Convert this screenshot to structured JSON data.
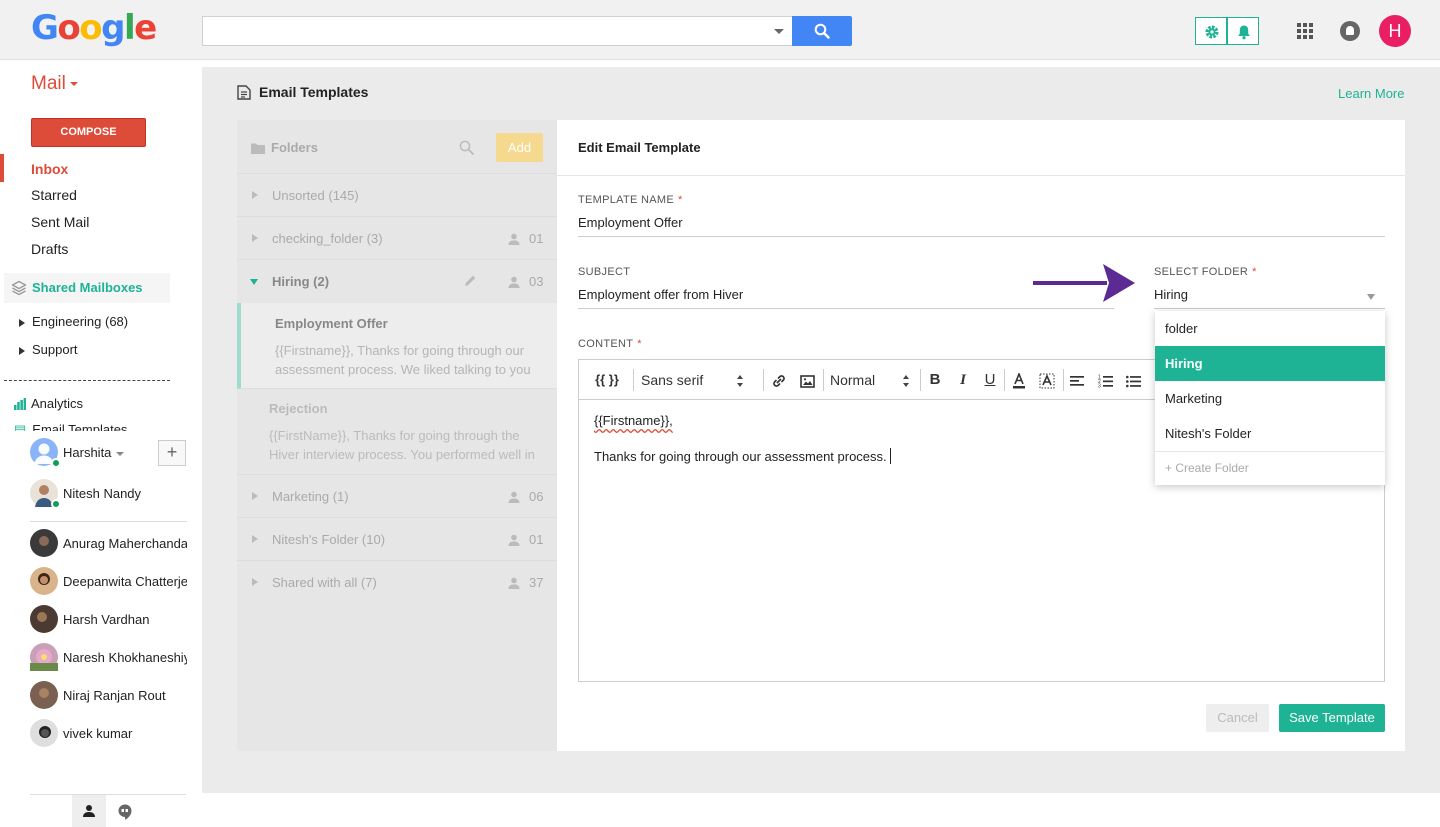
{
  "header": {
    "logo_letters": [
      "G",
      "o",
      "o",
      "g",
      "l",
      "e"
    ],
    "search_value": "",
    "avatar_letter": "H"
  },
  "nav": {
    "mail_label": "Mail",
    "compose_label": "COMPOSE",
    "items": [
      "Inbox",
      "Starred",
      "Sent Mail",
      "Drafts"
    ],
    "shared_mailboxes": "Shared Mailboxes",
    "mailboxes": [
      "Engineering (68)",
      "Support"
    ],
    "analytics": "Analytics",
    "email_templates": "Email Templates",
    "contacts": [
      "Harshita",
      "Nitesh Nandy",
      "Anurag Maherchandani",
      "Deepanwita Chatterjee",
      "Harsh Vardhan",
      "Naresh Khokhaneshiya",
      "Niraj Ranjan Rout",
      "vivek kumar"
    ]
  },
  "page": {
    "title": "Email Templates",
    "learn_more": "Learn More"
  },
  "folders": {
    "header": "Folders",
    "add_label": "Add",
    "rows": [
      {
        "name": "Unsorted (145)",
        "count": ""
      },
      {
        "name": "checking_folder (3)",
        "count": "01"
      },
      {
        "name": "Hiring (2)",
        "count": "03"
      },
      {
        "name": "Marketing (1)",
        "count": "06"
      },
      {
        "name": "Nitesh's Folder (10)",
        "count": "01"
      },
      {
        "name": "Shared with all (7)",
        "count": "37"
      }
    ],
    "templates": [
      {
        "title": "Employment Offer",
        "preview": "{{Firstname}}, Thanks for going through our assessment process. We liked talking to you"
      },
      {
        "title": "Rejection",
        "preview": "{{FirstName}}, Thanks for going through the Hiver interview process. You performed well in"
      }
    ]
  },
  "editor": {
    "header": "Edit Email Template",
    "template_name_label": "TEMPLATE NAME",
    "template_name_value": "Employment Offer",
    "subject_label": "SUBJECT",
    "subject_value": "Employment offer from Hiver",
    "select_folder_label": "SELECT FOLDER",
    "select_folder_value": "Hiring",
    "content_label": "CONTENT",
    "required_mark": "*",
    "toolbar": {
      "variables": "{{ }}",
      "font": "Sans serif",
      "size": "Normal"
    },
    "body_line1": "{{Firstname}},",
    "body_line2": "Thanks for going through our assessment process.",
    "cancel_label": "Cancel",
    "save_label": "Save Template"
  },
  "dropdown": {
    "options": [
      "folder",
      "Hiring",
      "Marketing",
      "Nitesh's Folder"
    ],
    "selected": "Hiring",
    "create_label": "+ Create Folder"
  },
  "colors": {
    "accent": "#1db394",
    "gmail_red": "#dd4b39",
    "arrow": "#5b2a92"
  }
}
